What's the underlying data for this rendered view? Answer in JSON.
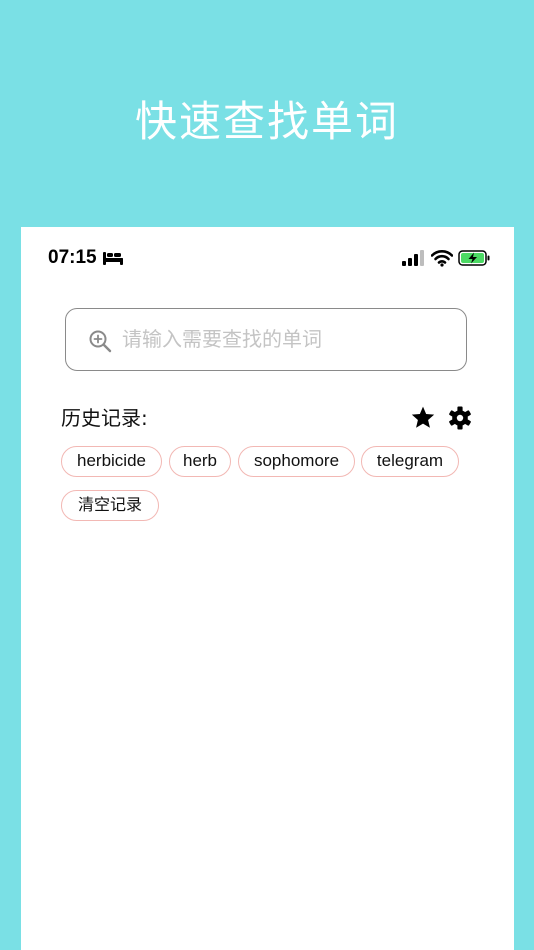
{
  "promo": {
    "title": "快速查找单词"
  },
  "status_bar": {
    "time": "07:15",
    "icons": [
      "bed-icon",
      "signal-icon",
      "wifi-icon",
      "battery-charging-icon"
    ]
  },
  "search": {
    "placeholder": "请输入需要查找的单词",
    "value": "",
    "icon": "zoom-in-icon"
  },
  "history": {
    "label": "历史记录:",
    "tags": [
      "herbicide",
      "herb",
      "sophomore",
      "telegram"
    ],
    "clear_label": "清空记录",
    "actions": [
      "star-icon",
      "gear-icon"
    ]
  },
  "colors": {
    "background": "#7ae0e5",
    "tag_border": "#f2b8b4",
    "battery_fill": "#4cd964"
  }
}
